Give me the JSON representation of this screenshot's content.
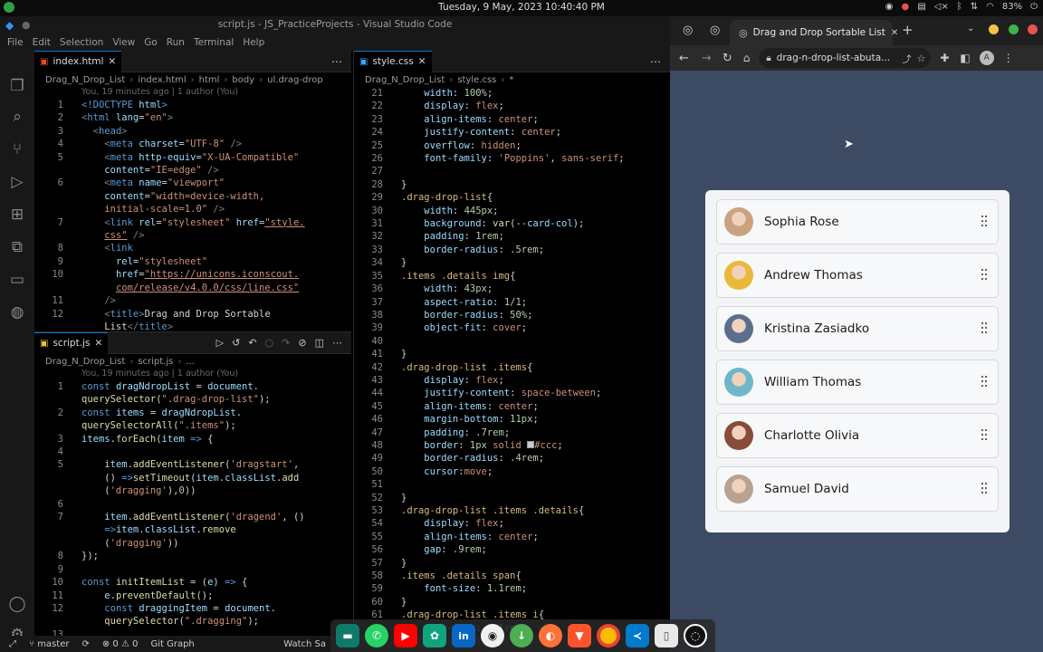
{
  "system_bar": {
    "datetime": "Tuesday, 9 May, 2023  10:40:40 PM",
    "battery": "83%"
  },
  "vscode": {
    "title": "script.js - JS_PracticeProjects - Visual Studio Code",
    "menu": [
      "File",
      "Edit",
      "Selection",
      "View",
      "Go",
      "Run",
      "Terminal",
      "Help"
    ],
    "editor_left_top": {
      "tab": "index.html",
      "breadcrumb": [
        "Drag_N_Drop_List",
        "index.html",
        "html",
        "body",
        "ul.drag-drop"
      ],
      "blame": "You, 19 minutes ago | 1 author (You)"
    },
    "editor_left_bottom": {
      "tab": "script.js",
      "breadcrumb": [
        "Drag_N_Drop_List",
        "script.js",
        "..."
      ],
      "blame": "You, 19 minutes ago | 1 author (You)"
    },
    "editor_right": {
      "tab": "style.css",
      "breadcrumb": [
        "Drag_N_Drop_List",
        "style.css",
        "*"
      ]
    },
    "status": {
      "branch": "master",
      "problems": "⊗ 0 ⚠ 0",
      "graph": "Git Graph",
      "watch": "Watch Sa"
    }
  },
  "browser": {
    "tab_title": "Drag and Drop Sortable List",
    "url": "drag-n-drop-list-abuta...",
    "profile_initial": "A",
    "items": [
      {
        "name": "Sophia Rose",
        "color": "#c9a27e"
      },
      {
        "name": "Andrew Thomas",
        "color": "#e8b93a"
      },
      {
        "name": "Kristina Zasiadko",
        "color": "#5a6f8c"
      },
      {
        "name": "William Thomas",
        "color": "#6fb6c9"
      },
      {
        "name": "Charlotte Olivia",
        "color": "#8a4c3a"
      },
      {
        "name": "Samuel David",
        "color": "#b7a392"
      }
    ]
  },
  "dock_apps": [
    "files",
    "whatsapp",
    "youtube",
    "chatgpt",
    "linkedin",
    "github",
    "download",
    "firefox",
    "brave",
    "chrome",
    "vscode",
    "document",
    "obs"
  ]
}
